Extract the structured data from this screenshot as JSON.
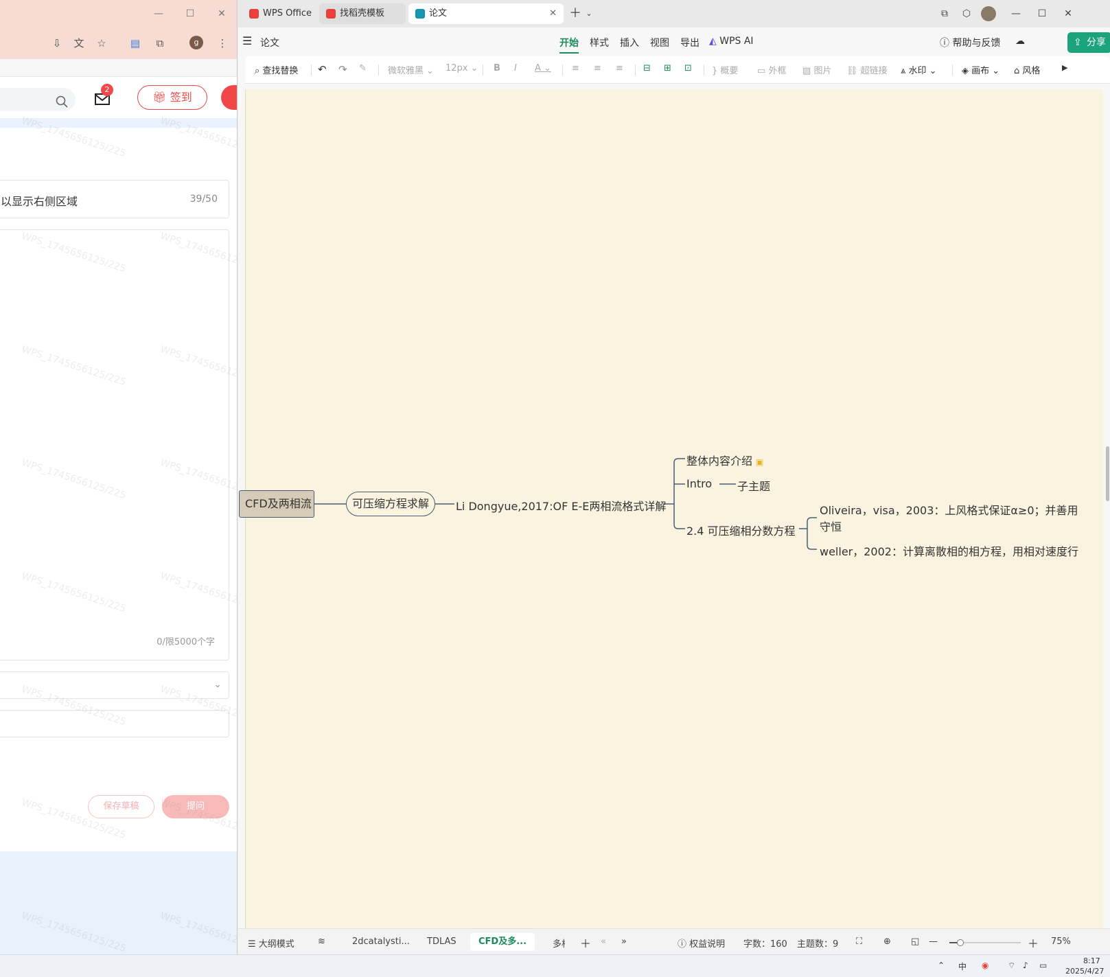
{
  "left_browser": {
    "header": {
      "mail_badge": "2",
      "signin_label": "签到"
    },
    "form": {
      "title_value": "以显示右侧区域",
      "title_counter": "39/50",
      "body_counter": "0/限5000个字",
      "save_draft_label": "保存草稿",
      "submit_label": "提问"
    },
    "watermark": "WPS_1745656125/225"
  },
  "wps": {
    "tabs": [
      {
        "label": "WPS Office"
      },
      {
        "label": "找稻壳模板"
      },
      {
        "label": "论文"
      }
    ],
    "doc_title": "论文",
    "menus": [
      "开始",
      "样式",
      "插入",
      "视图",
      "导出"
    ],
    "wps_ai": "WPS AI",
    "help": "帮助与反馈",
    "share": "分享",
    "ribbon": {
      "find_replace": "查找替换",
      "font": "微软雅黑",
      "size": "12px",
      "summary": "概要",
      "frame": "外框",
      "image": "图片",
      "hyperlink": "超链接",
      "watermark": "水印",
      "canvas": "画布",
      "style": "风格"
    },
    "mindmap": {
      "root": "CFD及两相流",
      "level1": "可压缩方程求解",
      "level2": "Li Dongyue,2017:OF E-E两相流格式详解",
      "children": [
        "整体内容介绍",
        "Intro",
        "2.4 可压缩相分数方程"
      ],
      "intro_child": "子主题",
      "refs": [
        "Oliveira，visa，2003：上风格式保证α≥0；并善用",
        "守恒",
        "weller，2002：计算离散相的相方程，用相对速度行"
      ]
    },
    "status": {
      "outline_mode": "大纲模式",
      "sheets": [
        "2dcatalysti...",
        "TDLAS",
        "CFD及多...",
        "多相"
      ],
      "rights": "权益说明",
      "word_count": "字数：160",
      "topic_count": "主题数：9",
      "zoom": "75%",
      "zoom_fraction": 0.15
    }
  },
  "taskbar": {
    "ime": "中",
    "time": "8:17",
    "date": "2025/4/27"
  },
  "colors": {
    "accent": "#1a8a5a",
    "share_bg": "#1ba37b",
    "canvas_bg": "#faf3e0",
    "brand_red": "#f04848",
    "node_fill": "#d6cbb6"
  }
}
